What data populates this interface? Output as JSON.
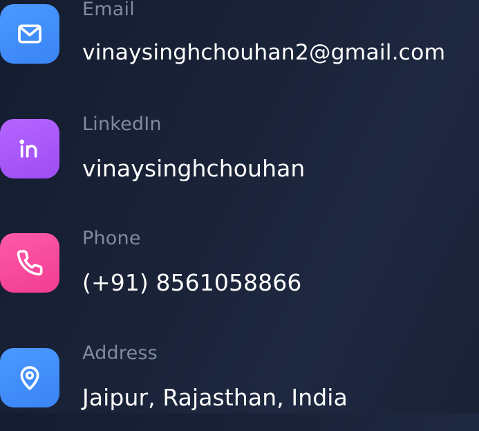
{
  "contacts": [
    {
      "icon": "mail-icon",
      "label": "Email",
      "value": "vinaysinghchouhan2@gmail.com",
      "color": "#3f8cff"
    },
    {
      "icon": "linkedin-icon",
      "label": "LinkedIn",
      "value": "vinaysinghchouhan",
      "color": "#a855f7"
    },
    {
      "icon": "phone-icon",
      "label": "Phone",
      "value": "(+91) 8561058866",
      "color": "#f74aa0"
    },
    {
      "icon": "map-pin-icon",
      "label": "Address",
      "value": "Jaipur, Rajasthan, India",
      "color": "#3f8cff"
    }
  ]
}
